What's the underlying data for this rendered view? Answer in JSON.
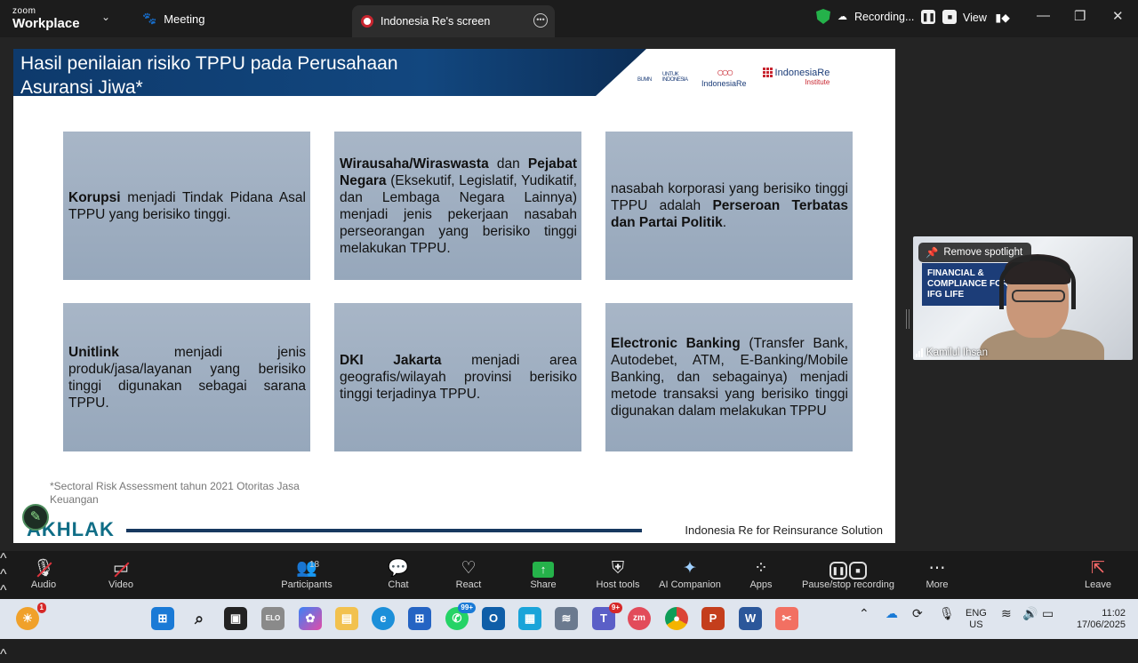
{
  "app": {
    "brand_top": "zoom",
    "brand_bottom": "Workplace"
  },
  "topbar": {
    "meeting_label": "Meeting",
    "tab_label": "Indonesia Re's screen",
    "recording_label": "Recording...",
    "view_label": "View"
  },
  "slide": {
    "title": "Hasil penilaian risiko TPPU pada Perusahaan Asuransi Jiwa*",
    "logos": {
      "bumn": "BUMN",
      "bumn_sub": "UNTUK INDONESIA",
      "ire": "IndonesiaRe",
      "iri": "IndonesiaRe",
      "iri_sub": "Institute"
    },
    "cards": [
      {
        "bold": "Korupsi",
        "text": " menjadi Tindak Pidana Asal TPPU yang berisiko tinggi."
      },
      {
        "bold": "Wirausaha/Wiraswasta",
        "text": " dan ",
        "bold2": "Pejabat Negara",
        "text2": " (Eksekutif, Legislatif, Yudikatif, dan Lembaga Negara Lainnya) menjadi jenis pekerjaan nasabah perseorangan yang berisiko tinggi melakukan TPPU."
      },
      {
        "pre": "nasabah korporasi yang berisiko tinggi TPPU adalah ",
        "bold": "Perseroan Terbatas dan Partai Politik",
        "text": "."
      },
      {
        "bold": "Unitlink",
        "text": " menjadi jenis produk/jasa/layanan yang berisiko tinggi digunakan sebagai sarana TPPU."
      },
      {
        "bold": "DKI Jakarta",
        "text": " menjadi area geografis/wilayah provinsi berisiko tinggi terjadinya TPPU."
      },
      {
        "bold": "Electronic Banking",
        "text": " (Transfer Bank, Autodebet, ATM, E-Banking/Mobile Banking, dan sebagainya) menjadi metode transaksi yang berisiko tinggi digunakan dalam melakukan TPPU"
      }
    ],
    "footnote": "*Sectoral Risk Assessment tahun 2021 Otoritas Jasa Keuangan",
    "akhlak": "AKHLAK",
    "tagline": "Indonesia Re for Reinsurance Solution"
  },
  "video": {
    "spotlight_label": "Remove spotlight",
    "participant_name": "Kamilul Ihsan",
    "banner_text": "FINANCIAL & COMPLIANCE FOR IFG LIFE"
  },
  "toolbar": {
    "audio": "Audio",
    "video": "Video",
    "participants": "Participants",
    "participants_count": "18",
    "chat": "Chat",
    "react": "React",
    "share": "Share",
    "host_tools": "Host tools",
    "ai_companion": "AI Companion",
    "apps": "Apps",
    "pause_stop": "Pause/stop recording",
    "more": "More",
    "leave": "Leave"
  },
  "taskbar": {
    "lang_top": "ENG",
    "lang_bottom": "US",
    "time": "11:02",
    "date": "17/06/2025",
    "badge_weather": "1",
    "badge_whatsapp": "99+",
    "badge_teams": "9+"
  },
  "colors": {
    "accent_green": "#25b24a",
    "slide_navy": "#12477f",
    "card_gray": "#a0b0c2",
    "danger": "#e0333d"
  }
}
